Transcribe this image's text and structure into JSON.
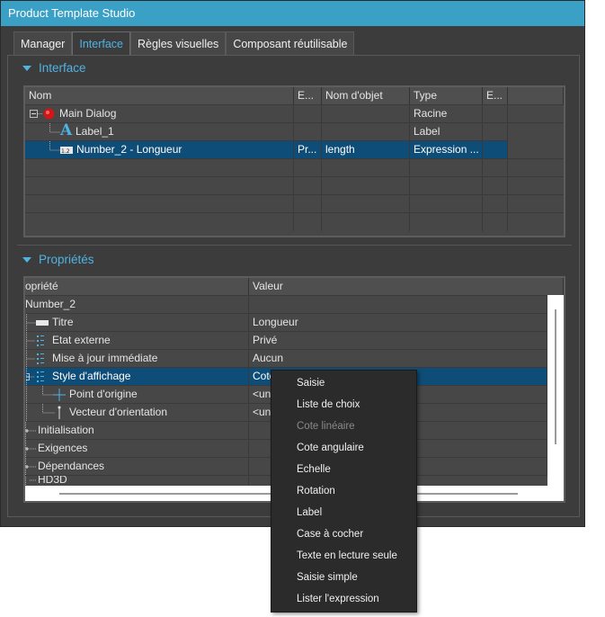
{
  "window": {
    "title": "Product Template Studio"
  },
  "tabs": [
    {
      "label": "Manager"
    },
    {
      "label": "Interface"
    },
    {
      "label": "Règles visuelles"
    },
    {
      "label": "Composant réutilisable"
    }
  ],
  "active_tab": "Interface",
  "interface_section": {
    "title": "Interface",
    "columns": [
      "Nom",
      "E...",
      "Nom d'objet",
      "Type",
      "E..."
    ],
    "rows": [
      {
        "name": "Main Dialog",
        "e1": "",
        "object": "",
        "type": "Racine",
        "e2": ""
      },
      {
        "name": "Label_1",
        "e1": "",
        "object": "",
        "type": "Label",
        "e2": ""
      },
      {
        "name": "Number_2 - Longueur",
        "e1": "Pr...",
        "object": "length",
        "type": "Expression ...",
        "e2": ""
      }
    ]
  },
  "properties_section": {
    "title": "Propriétés",
    "columns": [
      "opriété",
      "Valeur"
    ],
    "rows": [
      {
        "name": "Number_2",
        "value": ""
      },
      {
        "name": "Titre",
        "value": "Longueur"
      },
      {
        "name": "Etat externe",
        "value": "Privé"
      },
      {
        "name": "Mise à jour immédiate",
        "value": "Aucun"
      },
      {
        "name": "Style d'affichage",
        "value": "Cote"
      },
      {
        "name": "Point d'origine",
        "value": "<un"
      },
      {
        "name": "Vecteur d'orientation",
        "value": "<un"
      },
      {
        "name": "Initialisation",
        "value": ""
      },
      {
        "name": "Exigences",
        "value": ""
      },
      {
        "name": "Dépendances",
        "value": ""
      },
      {
        "name": "HD3D",
        "value": ""
      }
    ]
  },
  "context_menu": {
    "items": [
      {
        "label": "Saisie",
        "enabled": true
      },
      {
        "label": "Liste de choix",
        "enabled": true
      },
      {
        "label": "Cote linéaire",
        "enabled": false
      },
      {
        "label": "Cote angulaire",
        "enabled": true
      },
      {
        "label": "Echelle",
        "enabled": true
      },
      {
        "label": "Rotation",
        "enabled": true
      },
      {
        "label": "Label",
        "enabled": true
      },
      {
        "label": "Case à cocher",
        "enabled": true
      },
      {
        "label": "Texte en lecture seule",
        "enabled": true
      },
      {
        "label": "Saisie simple",
        "enabled": true
      },
      {
        "label": "Lister l'expression",
        "enabled": true
      }
    ]
  },
  "colors": {
    "titlebar": "#3aa0c6",
    "accent": "#4fb3e3",
    "selection": "#0e4d78",
    "background": "#3c3c3c"
  }
}
